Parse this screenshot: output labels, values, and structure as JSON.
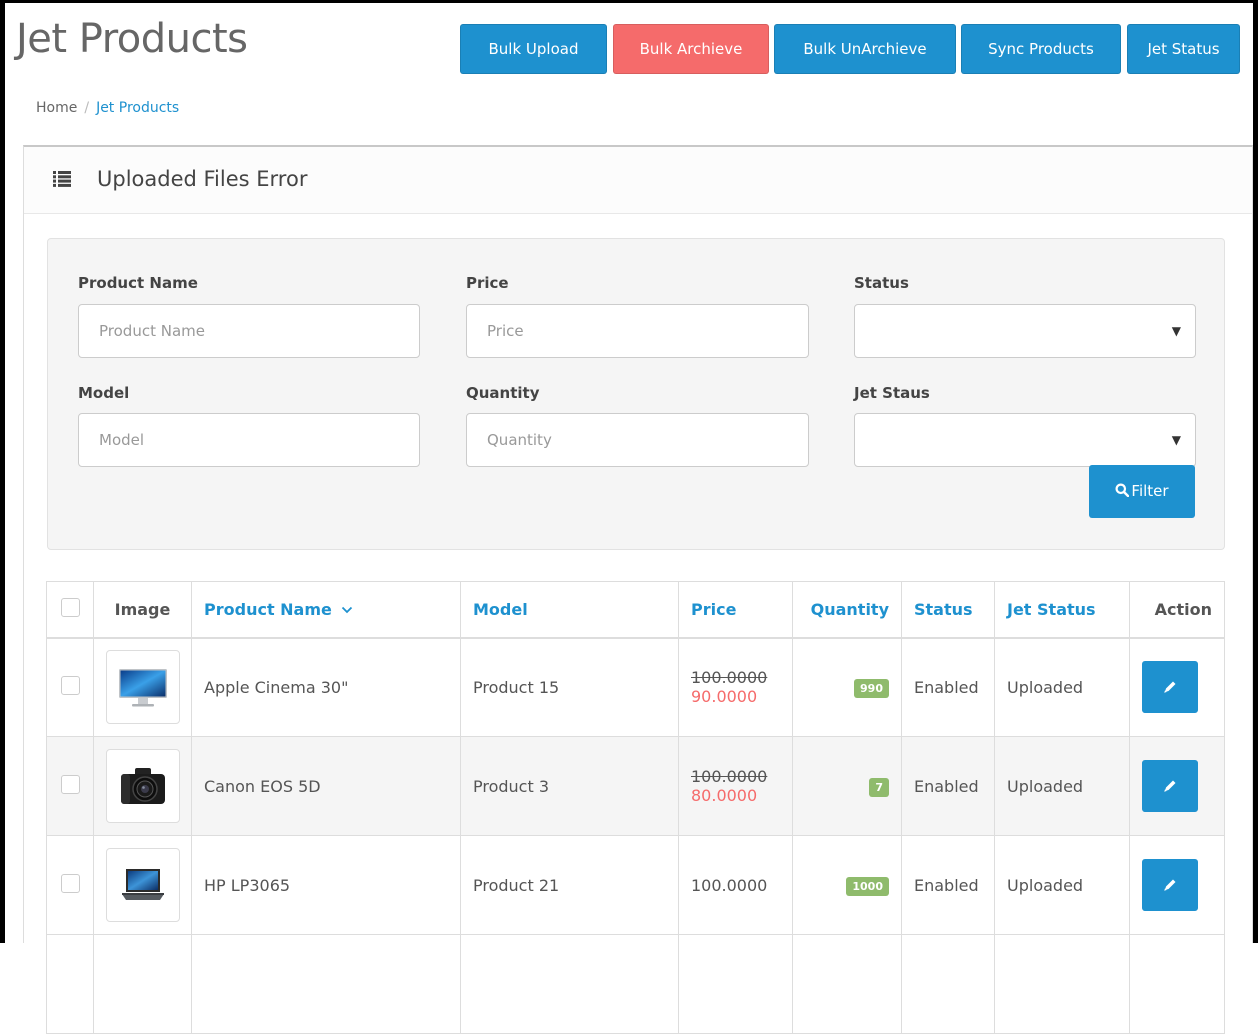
{
  "page": {
    "title": "Jet Products"
  },
  "toolbar": {
    "bulk_upload": "Bulk Upload",
    "bulk_archieve": "Bulk Archieve",
    "bulk_unarchieve": "Bulk UnArchieve",
    "sync_products": "Sync Products",
    "jet_status": "Jet Status"
  },
  "breadcrumb": {
    "home": "Home",
    "separator": "/",
    "current": "Jet Products"
  },
  "panel": {
    "title": "Uploaded Files Error"
  },
  "filters": {
    "product_name": {
      "label": "Product Name",
      "placeholder": "Product Name"
    },
    "price": {
      "label": "Price",
      "placeholder": "Price"
    },
    "status": {
      "label": "Status",
      "value": ""
    },
    "model": {
      "label": "Model",
      "placeholder": "Model"
    },
    "quantity": {
      "label": "Quantity",
      "placeholder": "Quantity"
    },
    "jet_status": {
      "label": "Jet Staus",
      "value": ""
    },
    "filter_button": "Filter"
  },
  "table": {
    "headers": {
      "image": "Image",
      "product_name": "Product Name",
      "model": "Model",
      "price": "Price",
      "quantity": "Quantity",
      "status": "Status",
      "jet_status": "Jet Status",
      "action": "Action"
    },
    "rows": [
      {
        "name": "Apple Cinema 30\"",
        "model": "Product 15",
        "price": "100.0000",
        "special": "90.0000",
        "quantity": "990",
        "status": "Enabled",
        "jet_status": "Uploaded",
        "image": "monitor-thumbnail"
      },
      {
        "name": "Canon EOS 5D",
        "model": "Product 3",
        "price": "100.0000",
        "special": "80.0000",
        "quantity": "7",
        "status": "Enabled",
        "jet_status": "Uploaded",
        "image": "camera-thumbnail"
      },
      {
        "name": "HP LP3065",
        "model": "Product 21",
        "price": "100.0000",
        "special": "",
        "quantity": "1000",
        "status": "Enabled",
        "jet_status": "Uploaded",
        "image": "laptop-thumbnail"
      }
    ]
  },
  "colors": {
    "primary": "#1e91cf",
    "danger": "#f56b6b",
    "badge_success": "#8fbb6c"
  }
}
